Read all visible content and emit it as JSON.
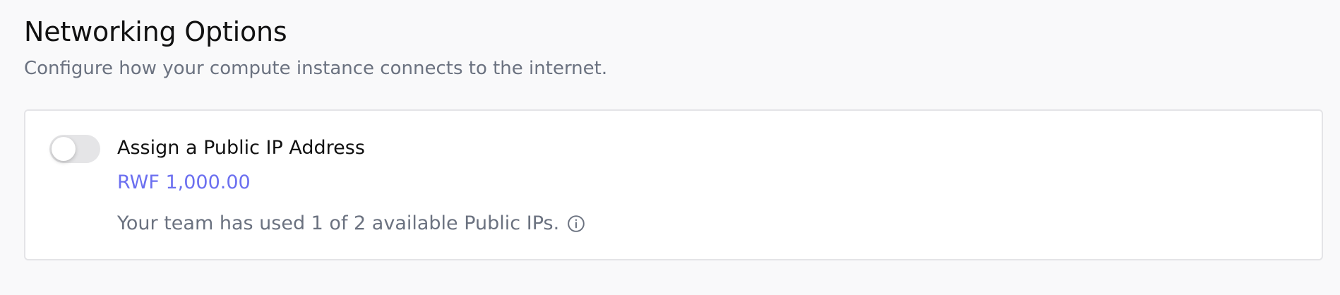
{
  "section": {
    "title": "Networking Options",
    "subtitle": "Configure how your compute instance connects to the internet."
  },
  "public_ip_option": {
    "toggle_state": "off",
    "label": "Assign a Public IP Address",
    "price": "RWF 1,000.00",
    "usage_text": "Your team has used 1 of 2 available Public IPs.",
    "info_icon": "info-icon"
  },
  "colors": {
    "accent_price": "#6b6ff0",
    "muted_text": "#6b7280",
    "toggle_off": "#e5e5e7"
  }
}
